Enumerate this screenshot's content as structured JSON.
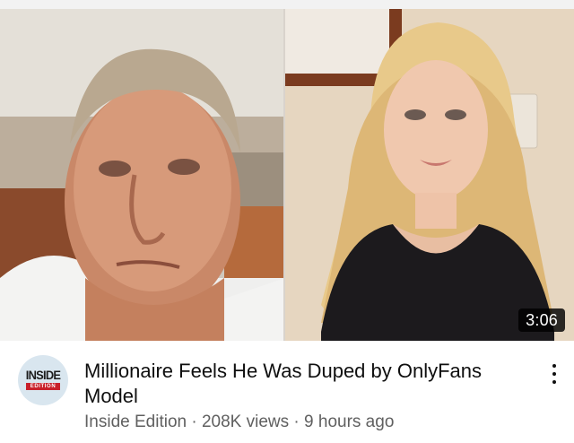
{
  "video": {
    "duration": "3:06",
    "title": "Millionaire Feels He Was Duped by OnlyFans Model",
    "channel": "Inside Edition",
    "views": "208K views",
    "age": "9 hours ago",
    "separator": " · "
  },
  "channel_logo": {
    "wordmark": "INSIDE",
    "subtitle": "EDITION"
  },
  "icons": {
    "more": "more-vertical-icon"
  },
  "colors": {
    "title": "#0f0f0f",
    "meta": "#606060",
    "logo_red": "#c8202a",
    "avatar_bg": "#d9e6ef"
  }
}
